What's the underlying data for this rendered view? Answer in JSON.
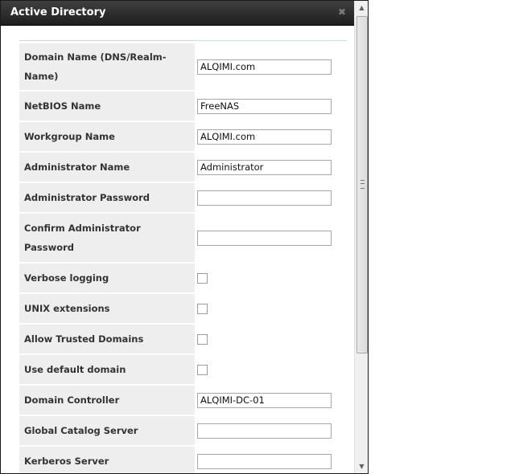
{
  "dialog": {
    "title": "Active Directory",
    "close_icon": "close-icon"
  },
  "form": {
    "fields": [
      {
        "label": "Domain Name (DNS/Realm-Name)",
        "type": "text",
        "value": "ALQIMI.com"
      },
      {
        "label": "NetBIOS Name",
        "type": "text",
        "value": "FreeNAS"
      },
      {
        "label": "Workgroup Name",
        "type": "text",
        "value": "ALQIMI.com"
      },
      {
        "label": "Administrator Name",
        "type": "text",
        "value": "Administrator"
      },
      {
        "label": "Administrator Password",
        "type": "password",
        "value": ""
      },
      {
        "label": "Confirm Administrator Password",
        "type": "password",
        "value": ""
      },
      {
        "label": "Verbose logging",
        "type": "checkbox",
        "checked": false
      },
      {
        "label": "UNIX extensions",
        "type": "checkbox",
        "checked": false
      },
      {
        "label": "Allow Trusted Domains",
        "type": "checkbox",
        "checked": false
      },
      {
        "label": "Use default domain",
        "type": "checkbox",
        "checked": false
      },
      {
        "label": "Domain Controller",
        "type": "text",
        "value": "ALQIMI-DC-01"
      },
      {
        "label": "Global Catalog Server",
        "type": "text",
        "value": ""
      },
      {
        "label": "Kerberos Server",
        "type": "text",
        "value": ""
      }
    ]
  },
  "colors": {
    "titlebar": "#2b2b2b",
    "label_bg": "#eeeeee",
    "divider": "#c5dde7"
  }
}
